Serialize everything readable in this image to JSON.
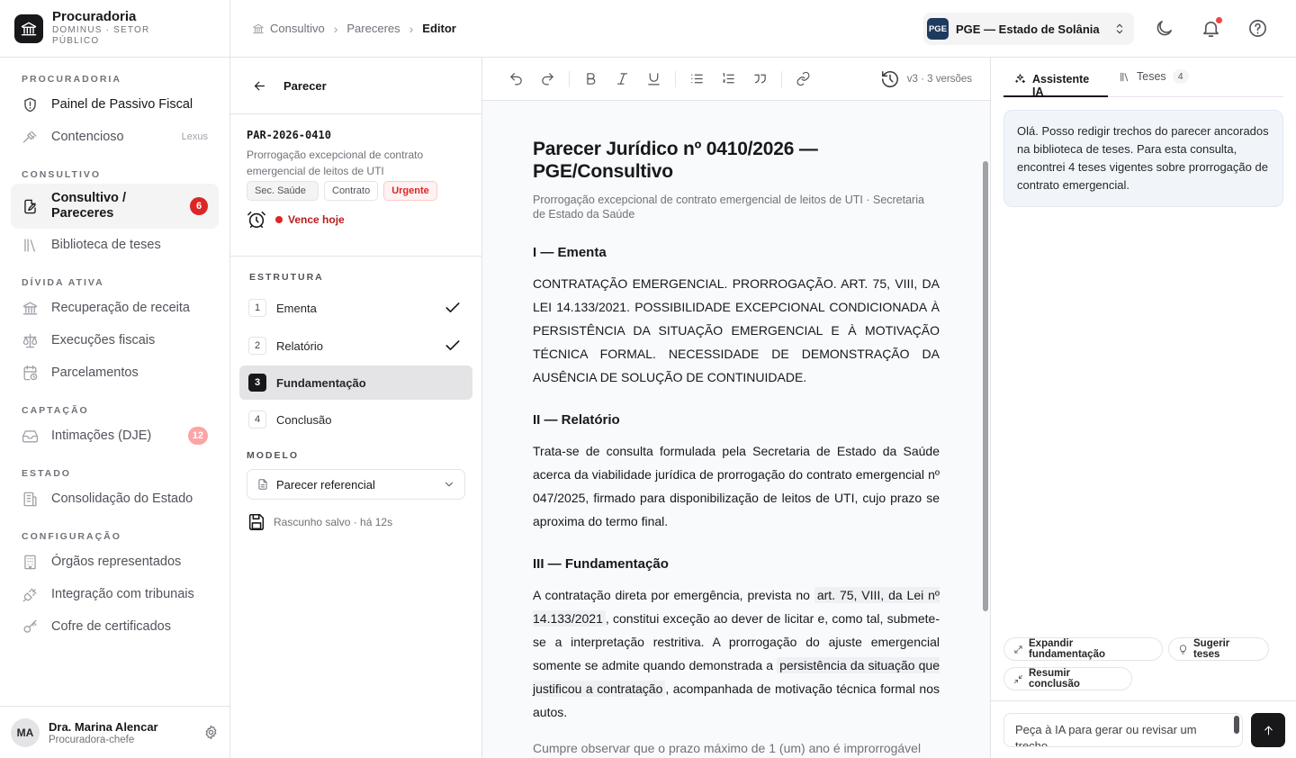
{
  "brand": {
    "title": "Procuradoria",
    "subtitle": "DOMINUS · SETOR PÚBLICO"
  },
  "sidebar": {
    "sections": [
      {
        "label": "PROCURADORIA",
        "items": [
          {
            "label": "Painel de Passivo Fiscal",
            "icon": "shield-icon"
          },
          {
            "label": "Contencioso",
            "icon": "gavel-icon",
            "tag": "Lexus"
          }
        ]
      },
      {
        "label": "CONSULTIVO",
        "items": [
          {
            "label": "Consultivo / Pareceres",
            "icon": "document-edit-icon",
            "badge": "6"
          },
          {
            "label": "Biblioteca de teses",
            "icon": "library-icon"
          }
        ]
      },
      {
        "label": "DÍVIDA ATIVA",
        "items": [
          {
            "label": "Recuperação de receita",
            "icon": "bank-icon"
          },
          {
            "label": "Execuções fiscais",
            "icon": "scale-icon"
          },
          {
            "label": "Parcelamentos",
            "icon": "calendar-clock-icon"
          }
        ]
      },
      {
        "label": "CAPTAÇÃO",
        "items": [
          {
            "label": "Intimações (DJE)",
            "icon": "inbox-icon",
            "badge": "12"
          }
        ]
      },
      {
        "label": "ESTADO",
        "items": [
          {
            "label": "Consolidação do Estado",
            "icon": "building-icon"
          }
        ]
      },
      {
        "label": "CONFIGURAÇÃO",
        "items": [
          {
            "label": "Órgãos representados",
            "icon": "building-icon"
          },
          {
            "label": "Integração com tribunais",
            "icon": "plug-icon"
          },
          {
            "label": "Cofre de certificados",
            "icon": "key-icon"
          }
        ]
      }
    ]
  },
  "user": {
    "initials": "MA",
    "name": "Dra. Marina Alencar",
    "role": "Procuradora-chefe"
  },
  "breadcrumb": {
    "items": [
      "Consultivo",
      "Pareceres"
    ],
    "current": "Editor"
  },
  "org": {
    "logo": "PGE",
    "name": "PGE — Estado de Solânia"
  },
  "structure": {
    "back_label": "Parecer",
    "code": "PAR-2026-0410",
    "description": "Prorrogação excepcional de contrato emergencial de leitos de UTI",
    "chips": [
      "Sec. Saúde",
      "Contrato",
      "Urgente"
    ],
    "due": "Vence hoje",
    "section_label": "ESTRUTURA",
    "steps": [
      {
        "num": "1",
        "label": "Ementa"
      },
      {
        "num": "2",
        "label": "Relatório"
      },
      {
        "num": "3",
        "label": "Fundamentação"
      },
      {
        "num": "4",
        "label": "Conclusão"
      }
    ],
    "model_label": "MODELO",
    "model_value": "Parecer referencial",
    "saved": "Rascunho salvo · há 12s"
  },
  "editor": {
    "versions": "v3 · 3 versões",
    "title": "Parecer Jurídico nº 0410/2026 — PGE/Consultivo",
    "subtitle": "Prorrogação excepcional de contrato emergencial de leitos de UTI · Secretaria de Estado da Saúde",
    "h_ementa": "I — Ementa",
    "ementa": "CONTRATAÇÃO EMERGENCIAL. PRORROGAÇÃO. ART. 75, VIII, DA LEI 14.133/2021. POSSIBILIDADE EXCEPCIONAL CONDICIONADA À PERSISTÊNCIA DA SITUAÇÃO EMERGENCIAL E À MOTIVAÇÃO TÉCNICA FORMAL. NECESSIDADE DE DEMONSTRAÇÃO DA AUSÊNCIA DE SOLUÇÃO DE CONTINUIDADE.",
    "h_relatorio": "II — Relatório",
    "relatorio": "Trata-se de consulta formulada pela Secretaria de Estado da Saúde acerca da viabilidade jurídica de prorrogação do contrato emergencial nº 047/2025, firmado para disponibilização de leitos de UTI, cujo prazo se aproxima do termo final.",
    "h_fund": "III — Fundamentação",
    "fund_1": "A contratação direta por emergência, prevista no",
    "fund_hl1": "art. 75, VIII, da Lei nº 14.133/2021",
    "fund_2": ", constitui exceção ao dever de licitar e, como tal, submete-se a interpretação restritiva. A prorrogação do ajuste emergencial somente se admite quando demonstrada a",
    "fund_hl2": "persistência da situação que justificou a contratação",
    "fund_3": ", acompanhada de motivação técnica formal nos autos.",
    "fund_next": "Cumpre observar que o prazo máximo de 1 (um) ano é improrrogável"
  },
  "assistant": {
    "tab_ai": "Assistente IA",
    "tab_teses": "Teses",
    "teses_count": "4",
    "message": "Olá. Posso redigir trechos do parecer ancorados na biblioteca de teses. Para esta consulta, encontrei 4 teses vigentes sobre prorrogação de contrato emergencial.",
    "suggestions": [
      "Expandir fundamentação",
      "Sugerir teses",
      "Resumir conclusão"
    ],
    "placeholder": "Peça à IA para gerar ou revisar um trecho"
  }
}
